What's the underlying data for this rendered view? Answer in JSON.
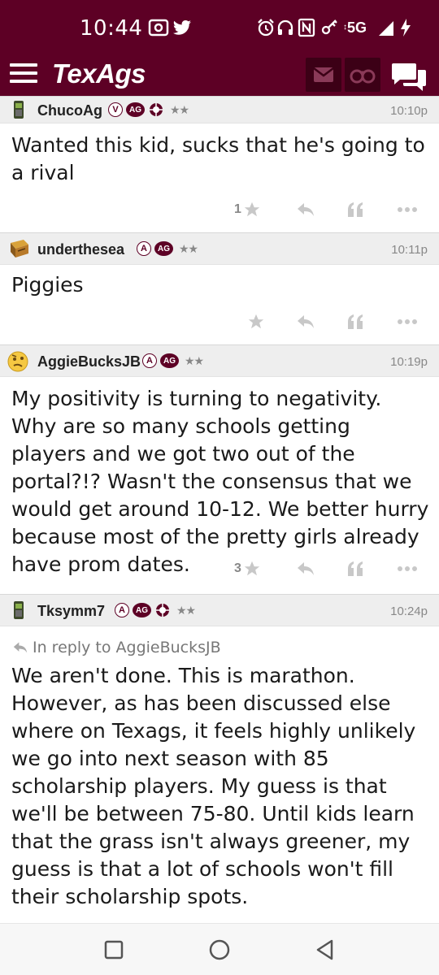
{
  "status_bar": {
    "time": "10:44",
    "icons_left": [
      "screenshot-icon",
      "twitter-icon"
    ],
    "icons_right": [
      "alarm-icon",
      "headphones-icon",
      "nfc-icon",
      "key-icon",
      "5g-icon",
      "signal-icon",
      "battery-charging-icon"
    ],
    "network": "5G"
  },
  "app_bar": {
    "brand": "TexAgs",
    "buttons": [
      "menu-icon",
      "mail-icon",
      "binoculars-icon",
      "chat-icon"
    ],
    "brand_color": "#5d0025"
  },
  "posts": [
    {
      "username": "ChucoAg",
      "avatar": "phone-avatar",
      "badges": [
        "V",
        "AG",
        "spur"
      ],
      "stars": "★★",
      "time": "10:10p",
      "body": "Wanted this kid, sucks that he's going to a rival",
      "likes": "1"
    },
    {
      "username": "underthesea",
      "avatar": "treasure-avatar",
      "badges": [
        "A",
        "AG"
      ],
      "stars": "★★",
      "time": "10:11p",
      "body": "Piggies",
      "likes": ""
    },
    {
      "username": "AggieBucksJB",
      "avatar": "confused-face-avatar",
      "badges": [
        "A",
        "AG"
      ],
      "stars": "★★",
      "time": "10:19p",
      "body": "My positivity is turning to negativity. Why are so many schools getting players and we got two out of the portal?!? Wasn't the consensus that we would get around 10-12. We better hurry because most of the pretty girls already have prom dates.",
      "likes": "3"
    },
    {
      "username": "Tksymm7",
      "avatar": "phone-avatar",
      "badges": [
        "A",
        "AG",
        "spur"
      ],
      "stars": "★★",
      "time": "10:24p",
      "reply_to": "In reply to AggieBucksJB",
      "body": "We aren't done. This is marathon. However, as has been discussed else where on Texags, it feels highly unlikely we go into next season with 85 scholarship players. My guess is that we'll be between 75-80. Until kids learn that the grass isn't always greener, my guess is that a lot of schools won't fill their scholarship spots."
    }
  ],
  "nav_bar": [
    "recents-icon",
    "home-icon",
    "back-icon"
  ]
}
